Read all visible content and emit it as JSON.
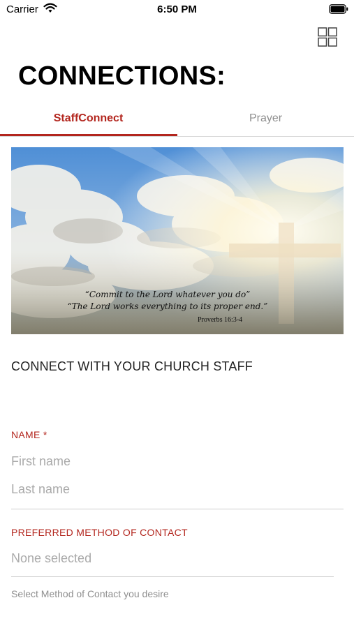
{
  "status_bar": {
    "carrier": "Carrier",
    "time": "6:50 PM"
  },
  "header": {
    "title": "CONNECTIONS:"
  },
  "tabs": [
    {
      "label": "StaffConnect",
      "active": true
    },
    {
      "label": "Prayer",
      "active": false
    }
  ],
  "banner": {
    "verse_line1": "“Commit to the Lord whatever you do”",
    "verse_line2": "“The Lord works everything to its proper end.”",
    "reference": "Proverbs 16:3-4"
  },
  "form": {
    "heading": "CONNECT WITH YOUR CHURCH STAFF",
    "name_label": "NAME *",
    "first_name_placeholder": "First name",
    "last_name_placeholder": "Last name",
    "contact_label": "PREFERRED METHOD OF CONTACT",
    "contact_value": "None selected",
    "contact_helper": "Select Method of Contact you desire"
  },
  "colors": {
    "accent": "#b3261e",
    "placeholder": "#aaaaaa"
  },
  "icons": [
    "wifi-icon",
    "battery-icon",
    "grid-menu-icon",
    "cross-image"
  ]
}
